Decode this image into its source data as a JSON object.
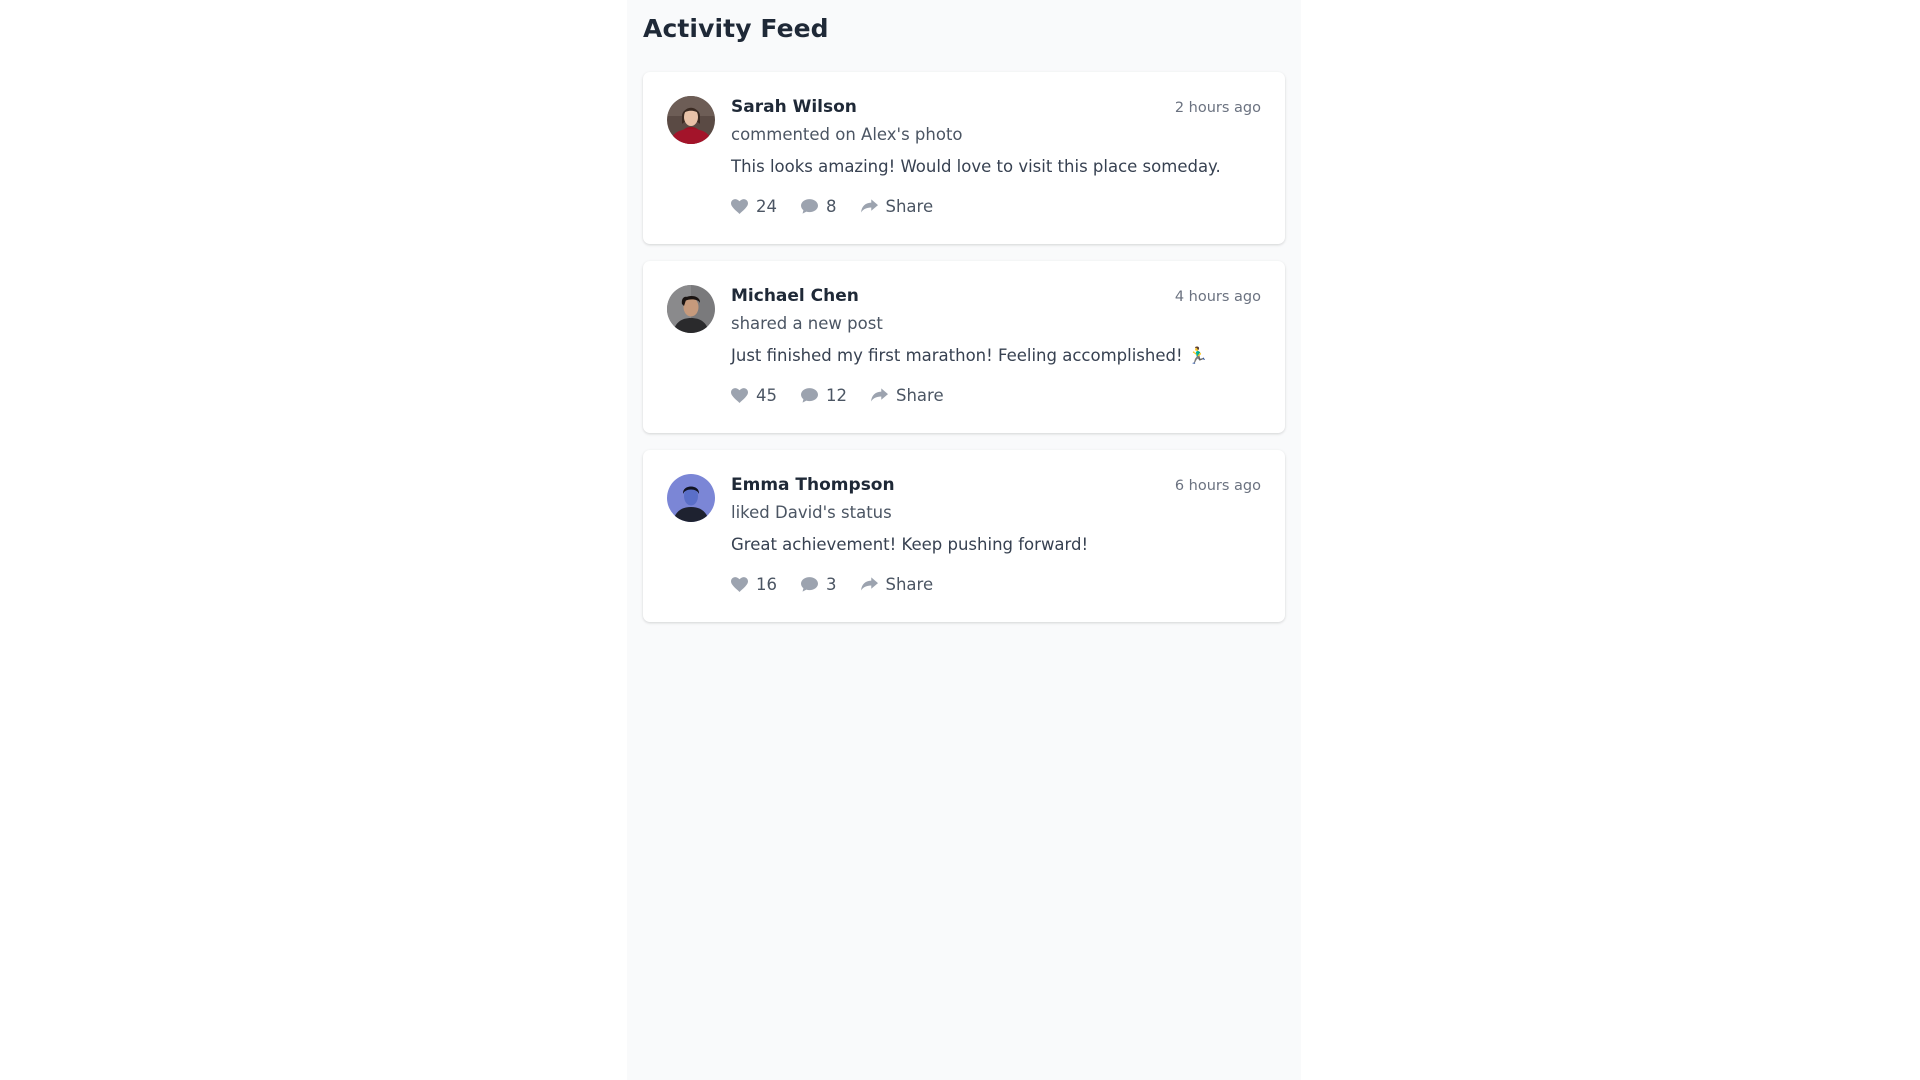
{
  "feed": {
    "title": "Activity Feed",
    "items": [
      {
        "user": "Sarah Wilson",
        "timestamp": "2 hours ago",
        "action": "commented on Alex's photo",
        "content": "This looks amazing! Would love to visit this place someday.",
        "likes": "24",
        "comments": "8",
        "share_label": "Share"
      },
      {
        "user": "Michael Chen",
        "timestamp": "4 hours ago",
        "action": "shared a new post",
        "content": "Just finished my first marathon! Feeling accomplished! 🏃‍♂️",
        "likes": "45",
        "comments": "12",
        "share_label": "Share"
      },
      {
        "user": "Emma Thompson",
        "timestamp": "6 hours ago",
        "action": "liked David's status",
        "content": "Great achievement! Keep pushing forward!",
        "likes": "16",
        "comments": "3",
        "share_label": "Share"
      }
    ]
  },
  "icons": {
    "like": "heart-icon",
    "comment": "comment-icon",
    "share": "share-icon"
  },
  "colors": {
    "page_background": "#f9fafb",
    "card_background": "#ffffff",
    "title_text": "#1f2937",
    "muted_text": "#6b7280",
    "icon_gray": "#9ca3af"
  }
}
